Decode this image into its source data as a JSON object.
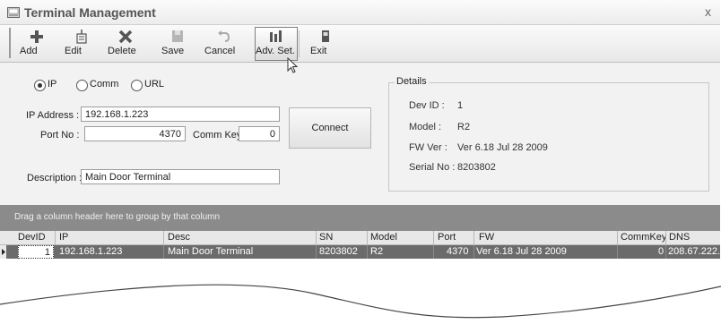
{
  "window": {
    "title": "Terminal Management",
    "close_glyph": "x"
  },
  "toolbar": {
    "buttons": [
      {
        "label": "Add",
        "icon": "plus-icon",
        "enabled": true
      },
      {
        "label": "Edit",
        "icon": "edit-icon",
        "enabled": true
      },
      {
        "label": "Delete",
        "icon": "delete-x-icon",
        "enabled": true
      },
      {
        "label": "Save",
        "icon": "save-icon",
        "enabled": false
      },
      {
        "label": "Cancel",
        "icon": "undo-icon",
        "enabled": false
      },
      {
        "label": "Adv. Set.",
        "icon": "advanced-settings-icon",
        "enabled": true,
        "pressed": true
      },
      {
        "label": "Exit",
        "icon": "exit-door-icon",
        "enabled": true
      }
    ]
  },
  "connection": {
    "options": [
      "IP",
      "Comm",
      "URL"
    ],
    "selected": "IP",
    "ip_label": "IP Address :",
    "ip_value": "192.168.1.223",
    "port_label": "Port No :",
    "port_value": "4370",
    "commkey_label": "Comm Key :",
    "commkey_value": "0",
    "connect_label": "Connect",
    "desc_label": "Description :",
    "desc_value": "Main Door Terminal"
  },
  "details": {
    "legend": "Details",
    "rows": [
      {
        "label": "Dev ID :",
        "value": "1"
      },
      {
        "label": "Model :",
        "value": "R2"
      },
      {
        "label": "FW Ver :",
        "value": "Ver 6.18 Jul 28 2009"
      },
      {
        "label": "Serial No :",
        "value": "8203802"
      }
    ]
  },
  "grid": {
    "group_hint": "Drag a column header here to group by that column",
    "columns": [
      "DevID",
      "IP",
      "Desc",
      "SN",
      "Model",
      "Port",
      "FW",
      "CommKey",
      "DNS"
    ],
    "rows": [
      [
        "1",
        "192.168.1.223",
        "Main Door Terminal",
        "8203802",
        "R2",
        "4370",
        "Ver 6.18 Jul 28 2009",
        "0",
        "208.67.222."
      ]
    ]
  },
  "colors": {
    "group_bar": "#8b8b8b",
    "selected_row": "#6b6b6b"
  }
}
